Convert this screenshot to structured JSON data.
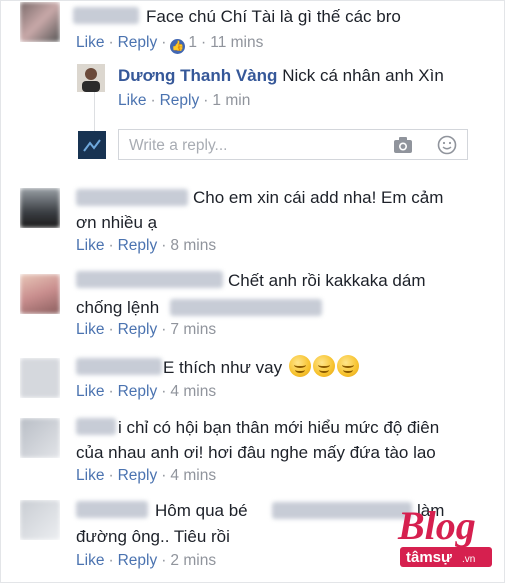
{
  "actions": {
    "like": "Like",
    "reply": "Reply",
    "sep": "·"
  },
  "comments": [
    {
      "text": "Face chú Chí Tài là gì thế các bro",
      "reactions": "1",
      "time": "11 mins"
    },
    {
      "author": "Dương Thanh Vàng",
      "text": "Nick cá nhân anh Xìn",
      "time": "1 min"
    },
    {
      "text_line1": "Cho em xin cái add nha! Em cảm",
      "text_line2": "ơn nhiều ạ",
      "time": "8 mins"
    },
    {
      "text_line1": "Chết anh rồi kakkaka dám",
      "text_line2": "chống lệnh",
      "time": "7 mins"
    },
    {
      "text": "E thích như vay",
      "time": "4 mins"
    },
    {
      "text_line1": "i chỉ có hội bạn thân mới hiểu mức độ điên",
      "text_line2": "của nhau anh ơi! hơi đâu nghe mấy đứa tào lao",
      "time": "4 mins"
    },
    {
      "text_line1": "Hôm qua bé",
      "text_line1_end": "làm",
      "text_line2": "đường ông.. Tiêu rồi",
      "time": "2 mins"
    }
  ],
  "reply_box": {
    "placeholder": "Write a reply..."
  },
  "watermark": {
    "brand": "Blog",
    "sub": "tâmsự",
    "tld": ".vn"
  },
  "colors": {
    "link": "#4b73b0",
    "author": "#365899",
    "muted": "#90949c",
    "brand_red": "#d6204f"
  }
}
